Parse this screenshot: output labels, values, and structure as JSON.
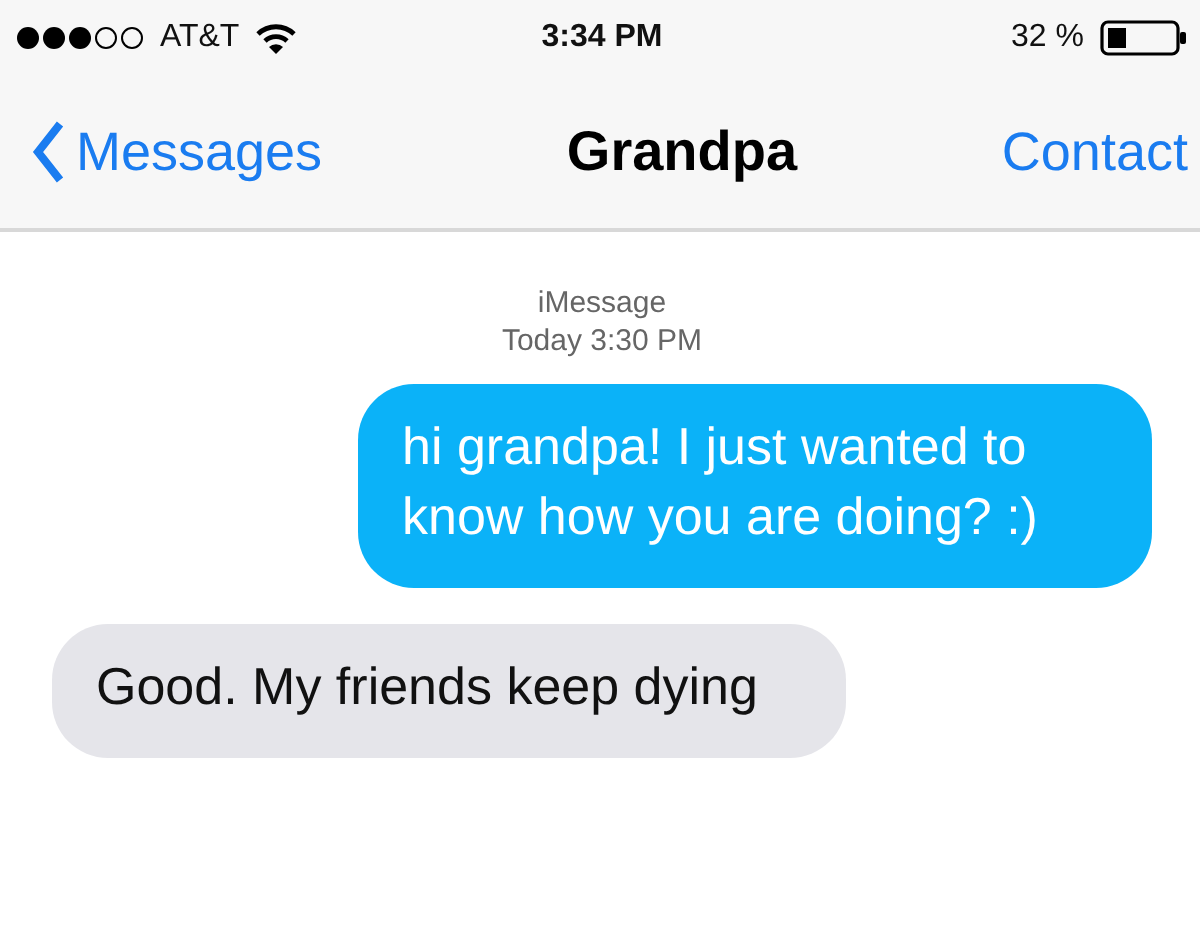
{
  "status_bar": {
    "carrier": "AT&T",
    "time": "3:34 PM",
    "battery": "32 %"
  },
  "nav_bar": {
    "back": "Messages",
    "title": "Grandpa",
    "action": "Contact"
  },
  "thread": {
    "service": "iMessage",
    "timestamp": "Today 3:30 PM"
  },
  "messages": [
    {
      "kind": "sent",
      "text": "hi grandpa! I just wanted to know how you are doing? :)"
    },
    {
      "kind": "received",
      "text": "Good. My friends keep dying"
    }
  ]
}
